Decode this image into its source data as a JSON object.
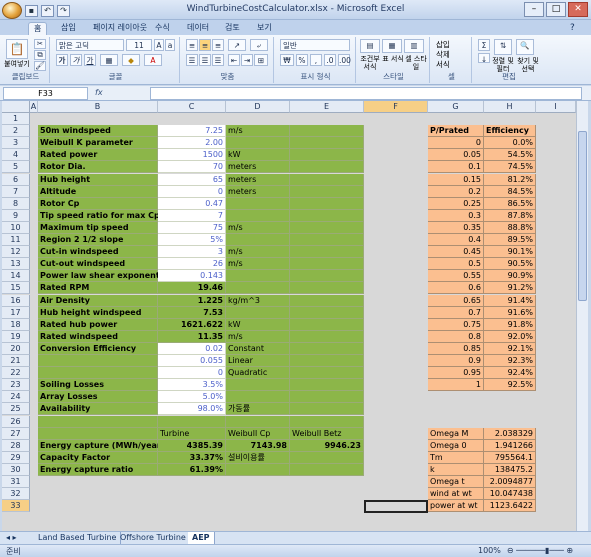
{
  "window": {
    "title": "WindTurbineCostCalculator.xlsx - Microsoft Excel"
  },
  "ribbon_tabs": [
    "홈",
    "삽입",
    "페이지 레이아웃",
    "수식",
    "데이터",
    "검토",
    "보기"
  ],
  "ribbon": {
    "paste": "붙여넣기",
    "font_name": "맑은 고딕",
    "font_size": "11",
    "number_format": "일반",
    "cond_format": "조건부 서식",
    "table_format": "표 서식",
    "cell_style": "셀 스타일",
    "insert": "삽입",
    "delete": "삭제",
    "format": "서식",
    "sort_filter": "정렬 및 필터",
    "find_select": "찾기 및 선택",
    "groups": [
      "클립보드",
      "글꼴",
      "맞춤",
      "표시 형식",
      "스타일",
      "셀",
      "편집"
    ]
  },
  "formula_bar": {
    "name_box": "F33",
    "fx": "fx",
    "content": ""
  },
  "columns": [
    "A",
    "B",
    "C",
    "D",
    "E",
    "F",
    "G",
    "H",
    "I"
  ],
  "rows": [
    "1",
    "2",
    "3",
    "4",
    "5",
    "6",
    "7",
    "8",
    "9",
    "10",
    "11",
    "12",
    "13",
    "14",
    "15",
    "16",
    "17",
    "18",
    "19",
    "20",
    "21",
    "22",
    "23",
    "24",
    "25",
    "26",
    "27",
    "28",
    "29",
    "30",
    "31",
    "32",
    "33"
  ],
  "inputs": [
    {
      "label": "50m windspeed",
      "value": "7.25",
      "unit": "m/s"
    },
    {
      "label": "Weibull K parameter",
      "value": "2.00",
      "unit": ""
    },
    {
      "label": "Rated power",
      "value": "1500",
      "unit": "kW"
    },
    {
      "label": "Rotor Dia.",
      "value": "70",
      "unit": "meters"
    },
    {
      "label": "Hub height",
      "value": "65",
      "unit": "meters"
    },
    {
      "label": "Altitude",
      "value": "0",
      "unit": "meters"
    },
    {
      "label": "Rotor Cp",
      "value": "0.47",
      "unit": ""
    },
    {
      "label": "Tip speed ratio for max Cp",
      "value": "7",
      "unit": ""
    },
    {
      "label": "Maximum tip speed",
      "value": "75",
      "unit": "m/s"
    },
    {
      "label": "Region 2 1/2 slope",
      "value": "5%",
      "unit": ""
    },
    {
      "label": "Cut-in windspeed",
      "value": "3",
      "unit": "m/s"
    },
    {
      "label": "Cut-out windspeed",
      "value": "26",
      "unit": "m/s"
    },
    {
      "label": "Power law shear exponent",
      "value": "0.143",
      "unit": ""
    }
  ],
  "computed": [
    {
      "label": "Rated RPM",
      "value": "19.46",
      "unit": ""
    },
    {
      "label": "Air Density",
      "value": "1.225",
      "unit": "kg/m^3"
    },
    {
      "label": "Hub height windspeed",
      "value": "7.53",
      "unit": ""
    },
    {
      "label": "Rated hub power",
      "value": "1621.622",
      "unit": "kW"
    },
    {
      "label": "Rated windspeed",
      "value": "11.35",
      "unit": "m/s"
    }
  ],
  "conversion": [
    {
      "label": "Conversion Efficiency",
      "value": "0.02",
      "unit": "Constant"
    },
    {
      "label": "",
      "value": "0.055",
      "unit": "Linear"
    },
    {
      "label": "",
      "value": "0",
      "unit": "Quadratic"
    }
  ],
  "losses": [
    {
      "label": "Soiling Losses",
      "value": "3.5%",
      "unit": ""
    },
    {
      "label": "Array Losses",
      "value": "5.0%",
      "unit": ""
    },
    {
      "label": "Availability",
      "value": "98.0%",
      "unit": "가동률"
    }
  ],
  "results_header": [
    "Turbine",
    "Weibull Cp",
    "Weibull Betz"
  ],
  "results": [
    {
      "label": "Energy capture (MWh/year)",
      "c": "4385.39",
      "d": "7143.98",
      "e": "9946.23"
    },
    {
      "label": "Capacity Factor",
      "c": "33.37%",
      "d": "설비이용률",
      "e": ""
    },
    {
      "label": "Energy capture ratio",
      "c": "61.39%",
      "d": "",
      "e": ""
    }
  ],
  "efficiency_table": {
    "headers": [
      "P/Prated",
      "Efficiency"
    ],
    "rows": [
      [
        "0",
        "0.0%"
      ],
      [
        "0.05",
        "54.5%"
      ],
      [
        "0.1",
        "74.5%"
      ],
      [
        "0.15",
        "81.2%"
      ],
      [
        "0.2",
        "84.5%"
      ],
      [
        "0.25",
        "86.5%"
      ],
      [
        "0.3",
        "87.8%"
      ],
      [
        "0.35",
        "88.8%"
      ],
      [
        "0.4",
        "89.5%"
      ],
      [
        "0.45",
        "90.1%"
      ],
      [
        "0.5",
        "90.5%"
      ],
      [
        "0.55",
        "90.9%"
      ],
      [
        "0.6",
        "91.2%"
      ],
      [
        "0.65",
        "91.4%"
      ],
      [
        "0.7",
        "91.6%"
      ],
      [
        "0.75",
        "91.8%"
      ],
      [
        "0.8",
        "92.0%"
      ],
      [
        "0.85",
        "92.1%"
      ],
      [
        "0.9",
        "92.3%"
      ],
      [
        "0.95",
        "92.4%"
      ],
      [
        "1",
        "92.5%"
      ]
    ]
  },
  "omega_table": [
    [
      "Omega M",
      "2.038329"
    ],
    [
      "Omega 0",
      "1.941266"
    ],
    [
      "Tm",
      "795564.1"
    ],
    [
      "k",
      "138475.2"
    ],
    [
      "Omega t",
      "2.0094877"
    ],
    [
      "wind at wt",
      "10.047438"
    ],
    [
      "power at wt",
      "1123.6422"
    ]
  ],
  "sheet_tabs": [
    "Land Based Turbine",
    "Offshore Turbine",
    "AEP"
  ],
  "status": {
    "left": "준비",
    "zoom": "100%"
  }
}
